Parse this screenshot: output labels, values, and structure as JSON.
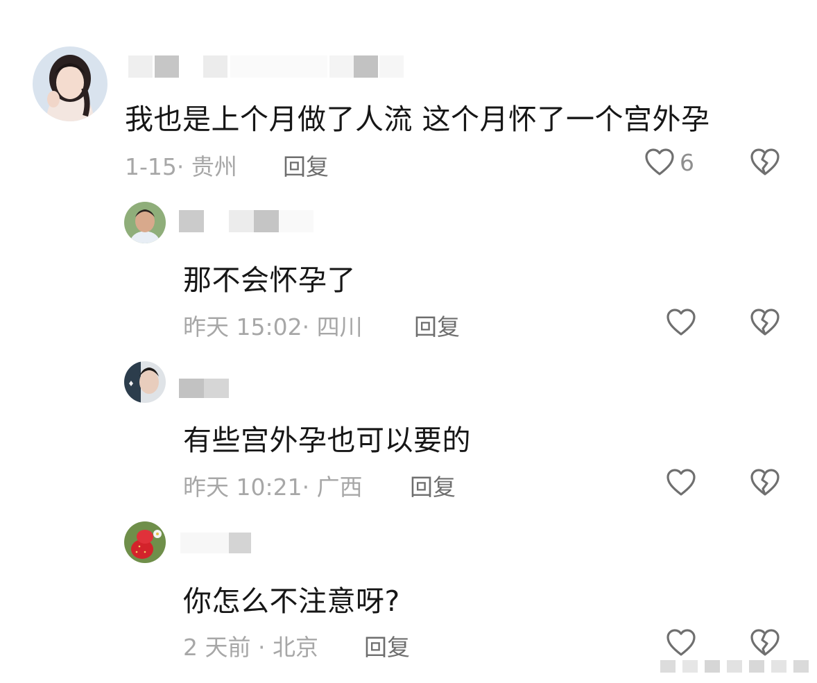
{
  "comments": [
    {
      "text": "我也是上个月做了人流 这个月怀了一个宫外孕",
      "meta": "1-15· 贵州",
      "reply": "回复",
      "likes": "6"
    },
    {
      "text": "那不会怀孕了",
      "meta": "昨天 15:02· 四川",
      "reply": "回复"
    },
    {
      "text": "有些宫外孕也可以要的",
      "meta": "昨天 10:21· 广西",
      "reply": "回复"
    },
    {
      "text": "你怎么不注意呀?",
      "meta": "2 天前 · 北京",
      "reply": "回复"
    }
  ],
  "icons": {
    "like": "heart-outline-icon",
    "dislike": "broken-heart-icon"
  },
  "colors": {
    "text": "#161616",
    "meta": "#a7a7a7",
    "reply": "#6e6e6e",
    "icon": "#6f6f6f"
  }
}
